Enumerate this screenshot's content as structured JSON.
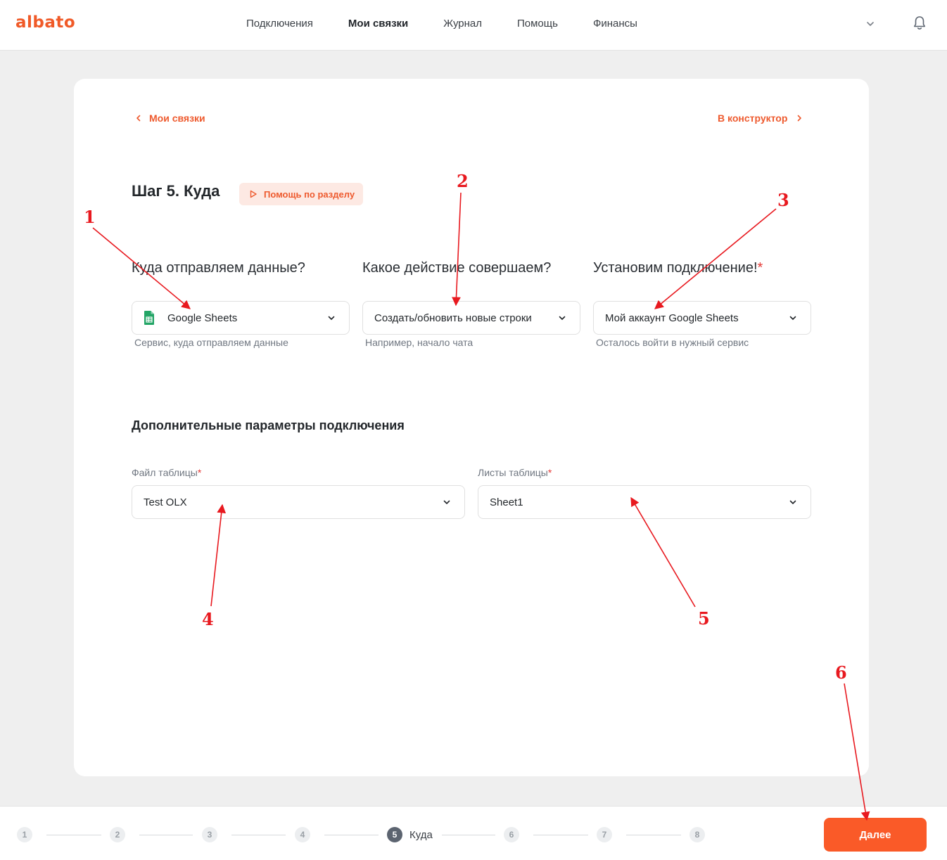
{
  "header": {
    "logo": "albato",
    "nav": [
      {
        "label": "Подключения",
        "active": false
      },
      {
        "label": "Мои связки",
        "active": true
      },
      {
        "label": "Журнал",
        "active": false
      },
      {
        "label": "Помощь",
        "active": false
      },
      {
        "label": "Финансы",
        "active": false
      }
    ]
  },
  "card": {
    "back_label": "Мои связки",
    "constructor_label": "В конструктор",
    "step_title": "Шаг 5. Куда",
    "help_label": "Помощь по разделу",
    "columns": [
      {
        "label": "Куда отправляем данные?",
        "required": false,
        "value": "Google Sheets",
        "hint": "Сервис, куда отправляем данные",
        "icon": "google-sheets-icon"
      },
      {
        "label": "Какое действие совершаем?",
        "required": false,
        "value": "Создать/обновить новые строки",
        "hint": "Например, начало чата"
      },
      {
        "label": "Установим подключение!",
        "required": true,
        "required_mark": "*",
        "value": "Мой аккаунт Google Sheets",
        "hint": "Осталось войти в нужный сервис"
      }
    ],
    "extra_section_title": "Дополнительные параметры подключения",
    "fields": [
      {
        "label": "Файл таблицы",
        "required_mark": "*",
        "value": "Test OLX"
      },
      {
        "label": "Листы таблицы",
        "required_mark": "*",
        "value": "Sheet1"
      }
    ]
  },
  "stepper": {
    "steps": [
      "1",
      "2",
      "3",
      "4",
      "5",
      "6",
      "7",
      "8"
    ],
    "current_step": 5,
    "current_label": "Куда",
    "next_label": "Далее"
  },
  "annotations": {
    "labels": [
      "1",
      "2",
      "3",
      "4",
      "5",
      "6"
    ],
    "color": "#e8191f"
  },
  "colors": {
    "accent": "#fa5a28",
    "link": "#ee5a2e",
    "background": "#efefef"
  }
}
